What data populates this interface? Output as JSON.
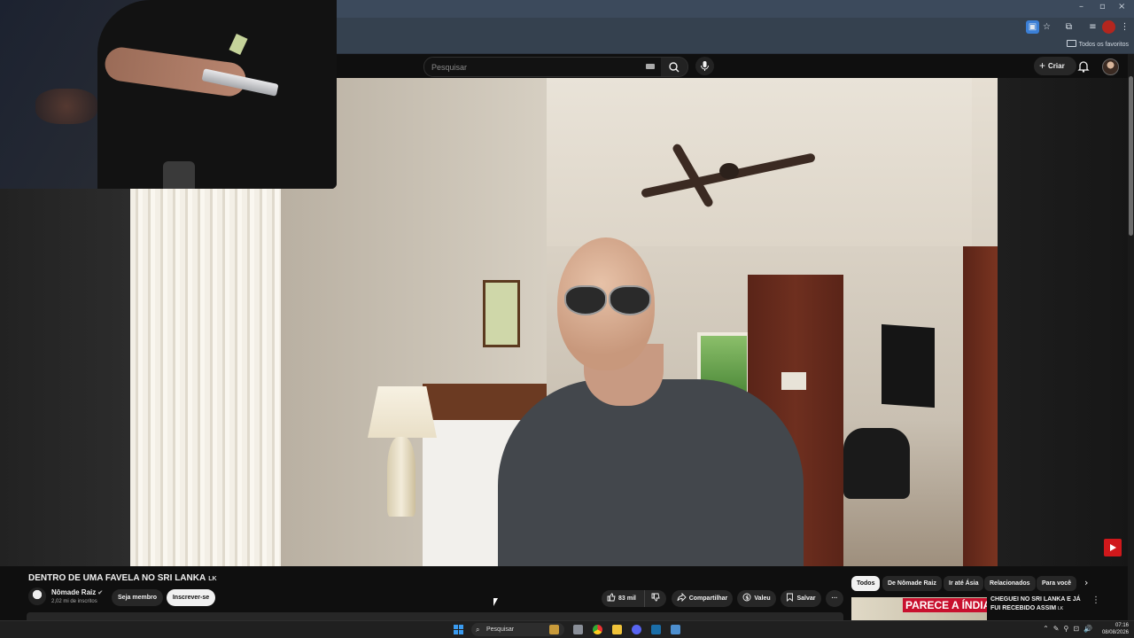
{
  "search": {
    "placeholder": "Pesquisar"
  },
  "header": {
    "create_label": "Criar"
  },
  "bookmarks": {
    "all_favorites": "Todos os favoritos"
  },
  "video": {
    "title": "DENTRO DE UMA FAVELA NO SRI LANKA",
    "title_flag": "LK",
    "channel": "Nômade Raiz",
    "verified_icon": "verified-check-icon",
    "subscribers": "2,02 mi de inscritos",
    "join_label": "Seja membro",
    "subscribe_label": "Inscrever-se",
    "like_count": "83 mil",
    "share_label": "Compartilhar",
    "thanks_label": "Valeu",
    "save_label": "Salvar"
  },
  "chips": [
    "Todos",
    "De Nômade Raiz",
    "Ir até Ásia",
    "Relacionados",
    "Para você"
  ],
  "recommended": {
    "thumb_text": "PARECE A ÍNDIA",
    "title": "CHEGUEI NO SRI LANKA E JÁ FUI RECEBIDO ASSIM",
    "title_flag": "LK"
  },
  "taskbar": {
    "search_label": "Pesquisar",
    "time": "07:16",
    "date": "08/08/2026"
  },
  "colors": {
    "accent": "#3a9bf0",
    "youtube_red": "#d0181b",
    "background": "#0f0f0f"
  }
}
